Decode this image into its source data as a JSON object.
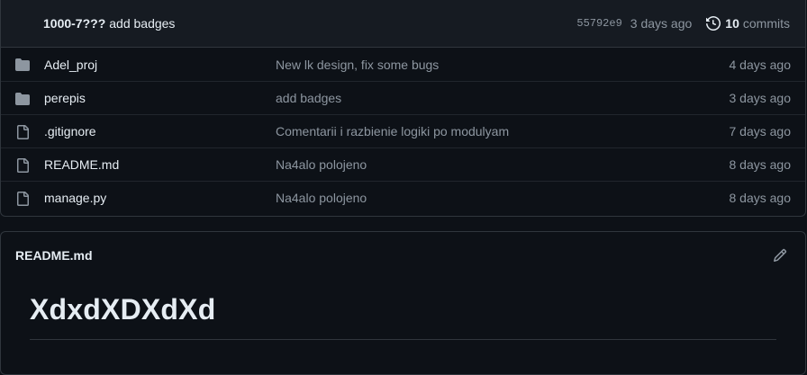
{
  "latest_commit": {
    "author": "1000-7???",
    "message": "add badges",
    "sha": "55792e9",
    "age": "3 days ago",
    "count": "10",
    "count_label": "commits"
  },
  "files": [
    {
      "type": "folder",
      "icon": "folder-icon",
      "name": "Adel_proj",
      "commit": "New lk design, fix some bugs",
      "age": "4 days ago"
    },
    {
      "type": "folder",
      "icon": "folder-icon",
      "name": "perepis",
      "commit": "add badges",
      "age": "3 days ago"
    },
    {
      "type": "file",
      "icon": "file-icon",
      "name": ".gitignore",
      "commit": "Comentarii i razbienie logiki po modulyam",
      "age": "7 days ago"
    },
    {
      "type": "file",
      "icon": "file-icon",
      "name": "README.md",
      "commit": "Na4alo polojeno",
      "age": "8 days ago"
    },
    {
      "type": "file",
      "icon": "file-icon",
      "name": "manage.py",
      "commit": "Na4alo polojeno",
      "age": "8 days ago"
    }
  ],
  "readme": {
    "filename": "README.md",
    "heading": "XdxdXDXdXd"
  },
  "colors": {
    "background": "#0d1117",
    "header_bg": "#161b22",
    "border": "#30363d",
    "muted_text": "#8d96a0",
    "icon": "#8d96a0"
  }
}
